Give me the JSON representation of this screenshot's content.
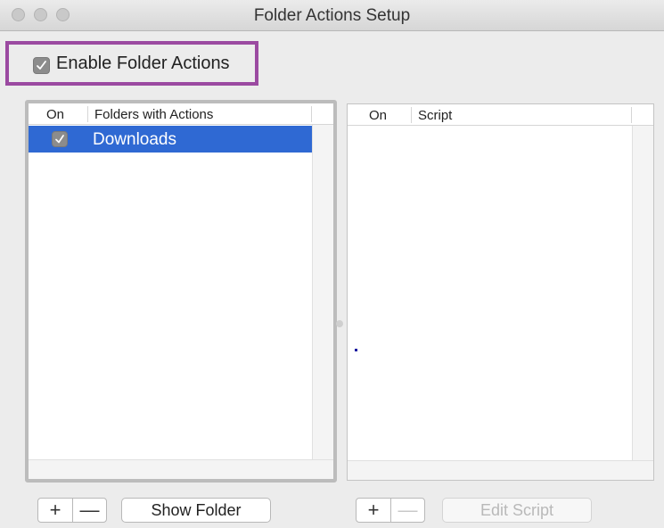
{
  "window": {
    "title": "Folder Actions Setup"
  },
  "enable_folder_actions": {
    "label": "Enable Folder Actions",
    "checked": true
  },
  "folders_table": {
    "columns": [
      "On",
      "Folders with Actions"
    ],
    "rows": [
      {
        "on": true,
        "name": "Downloads",
        "selected": true
      }
    ]
  },
  "scripts_table": {
    "columns": [
      "On",
      "Script"
    ],
    "rows": []
  },
  "buttons": {
    "folder_add": "+",
    "folder_remove": "—",
    "show_folder": "Show Folder",
    "script_add": "+",
    "script_remove": "—",
    "edit_script": "Edit Script"
  },
  "icons": {
    "check": "✓"
  },
  "colors": {
    "selection": "#2f69d3",
    "highlight_border": "#9b4aa1"
  }
}
